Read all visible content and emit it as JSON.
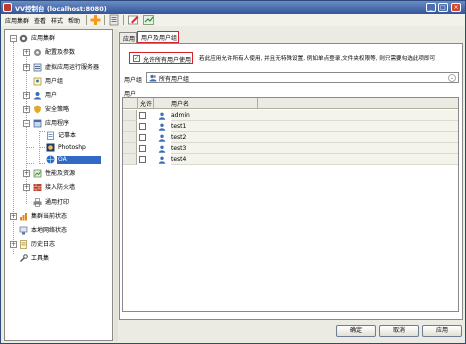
{
  "window": {
    "title": "VV控制台 (localhost:8080)",
    "controls": [
      "_",
      "□",
      "×"
    ]
  },
  "menu": [
    "应用集群",
    "查看",
    "样式",
    "帮助"
  ],
  "toolbar": {
    "buttons": [
      "add-icon",
      "properties-icon",
      "edit-icon",
      "refresh-icon"
    ]
  },
  "tree": {
    "nodes": [
      {
        "label": "应用集群",
        "icon": "cluster-icon",
        "toggle": "−",
        "level": 0
      },
      {
        "label": "配置及参数",
        "icon": "config-icon",
        "toggle": "+",
        "level": 1
      },
      {
        "label": "虚拟应用运行服务器",
        "icon": "server-icon",
        "toggle": "+",
        "level": 1
      },
      {
        "label": "用户组",
        "icon": "group-icon",
        "toggle": "",
        "level": 1
      },
      {
        "label": "用户",
        "icon": "user-icon",
        "toggle": "+",
        "level": 1
      },
      {
        "label": "安全策略",
        "icon": "shield-icon",
        "toggle": "+",
        "level": 1
      },
      {
        "label": "应用程序",
        "icon": "apps-icon",
        "toggle": "−",
        "level": 1
      },
      {
        "label": "记事本",
        "icon": "notepad-icon",
        "toggle": "",
        "level": 2
      },
      {
        "label": "Photoshp",
        "icon": "photoshop-icon",
        "toggle": "",
        "level": 2
      },
      {
        "label": "OA",
        "icon": "oa-icon",
        "toggle": "",
        "level": 2,
        "selected": true
      },
      {
        "label": "性能及资源",
        "icon": "performance-icon",
        "toggle": "+",
        "level": 1
      },
      {
        "label": "接入防火墙",
        "icon": "firewall-icon",
        "toggle": "+",
        "level": 1
      },
      {
        "label": "通用打印",
        "icon": "printer-icon",
        "toggle": "",
        "level": 1
      },
      {
        "label": "集群当前状态",
        "icon": "status-icon",
        "toggle": "+",
        "level": 0
      },
      {
        "label": "本地网络状态",
        "icon": "network-icon",
        "toggle": "",
        "level": 0
      },
      {
        "label": "历史日志",
        "icon": "log-icon",
        "toggle": "+",
        "level": 0
      },
      {
        "label": "工具集",
        "icon": "tools-icon",
        "toggle": "",
        "level": 0
      }
    ]
  },
  "tabs": [
    {
      "label": "应用",
      "active": false
    },
    {
      "label": "用户及用户组",
      "active": true
    }
  ],
  "allow_all": {
    "checked": true,
    "check_mark": "✓",
    "label": "允许所有用户使用"
  },
  "hint": "若此应用允许所有人使用, 并且无特殊设置, 例如单点登录,文件夹权限等, 则只需要勾选此项即可",
  "user_group": {
    "label": "用户组",
    "selected": "所有用户组",
    "arrow": "⌄"
  },
  "users_section_label": "用户",
  "table": {
    "columns": [
      "允许",
      "用户名"
    ],
    "rows": [
      {
        "allowed": false,
        "name": "admin"
      },
      {
        "allowed": false,
        "name": "test1"
      },
      {
        "allowed": false,
        "name": "test2"
      },
      {
        "allowed": false,
        "name": "test3"
      },
      {
        "allowed": false,
        "name": "test4"
      }
    ]
  },
  "buttons": {
    "ok": "确定",
    "cancel": "取消",
    "apply": "应用"
  }
}
